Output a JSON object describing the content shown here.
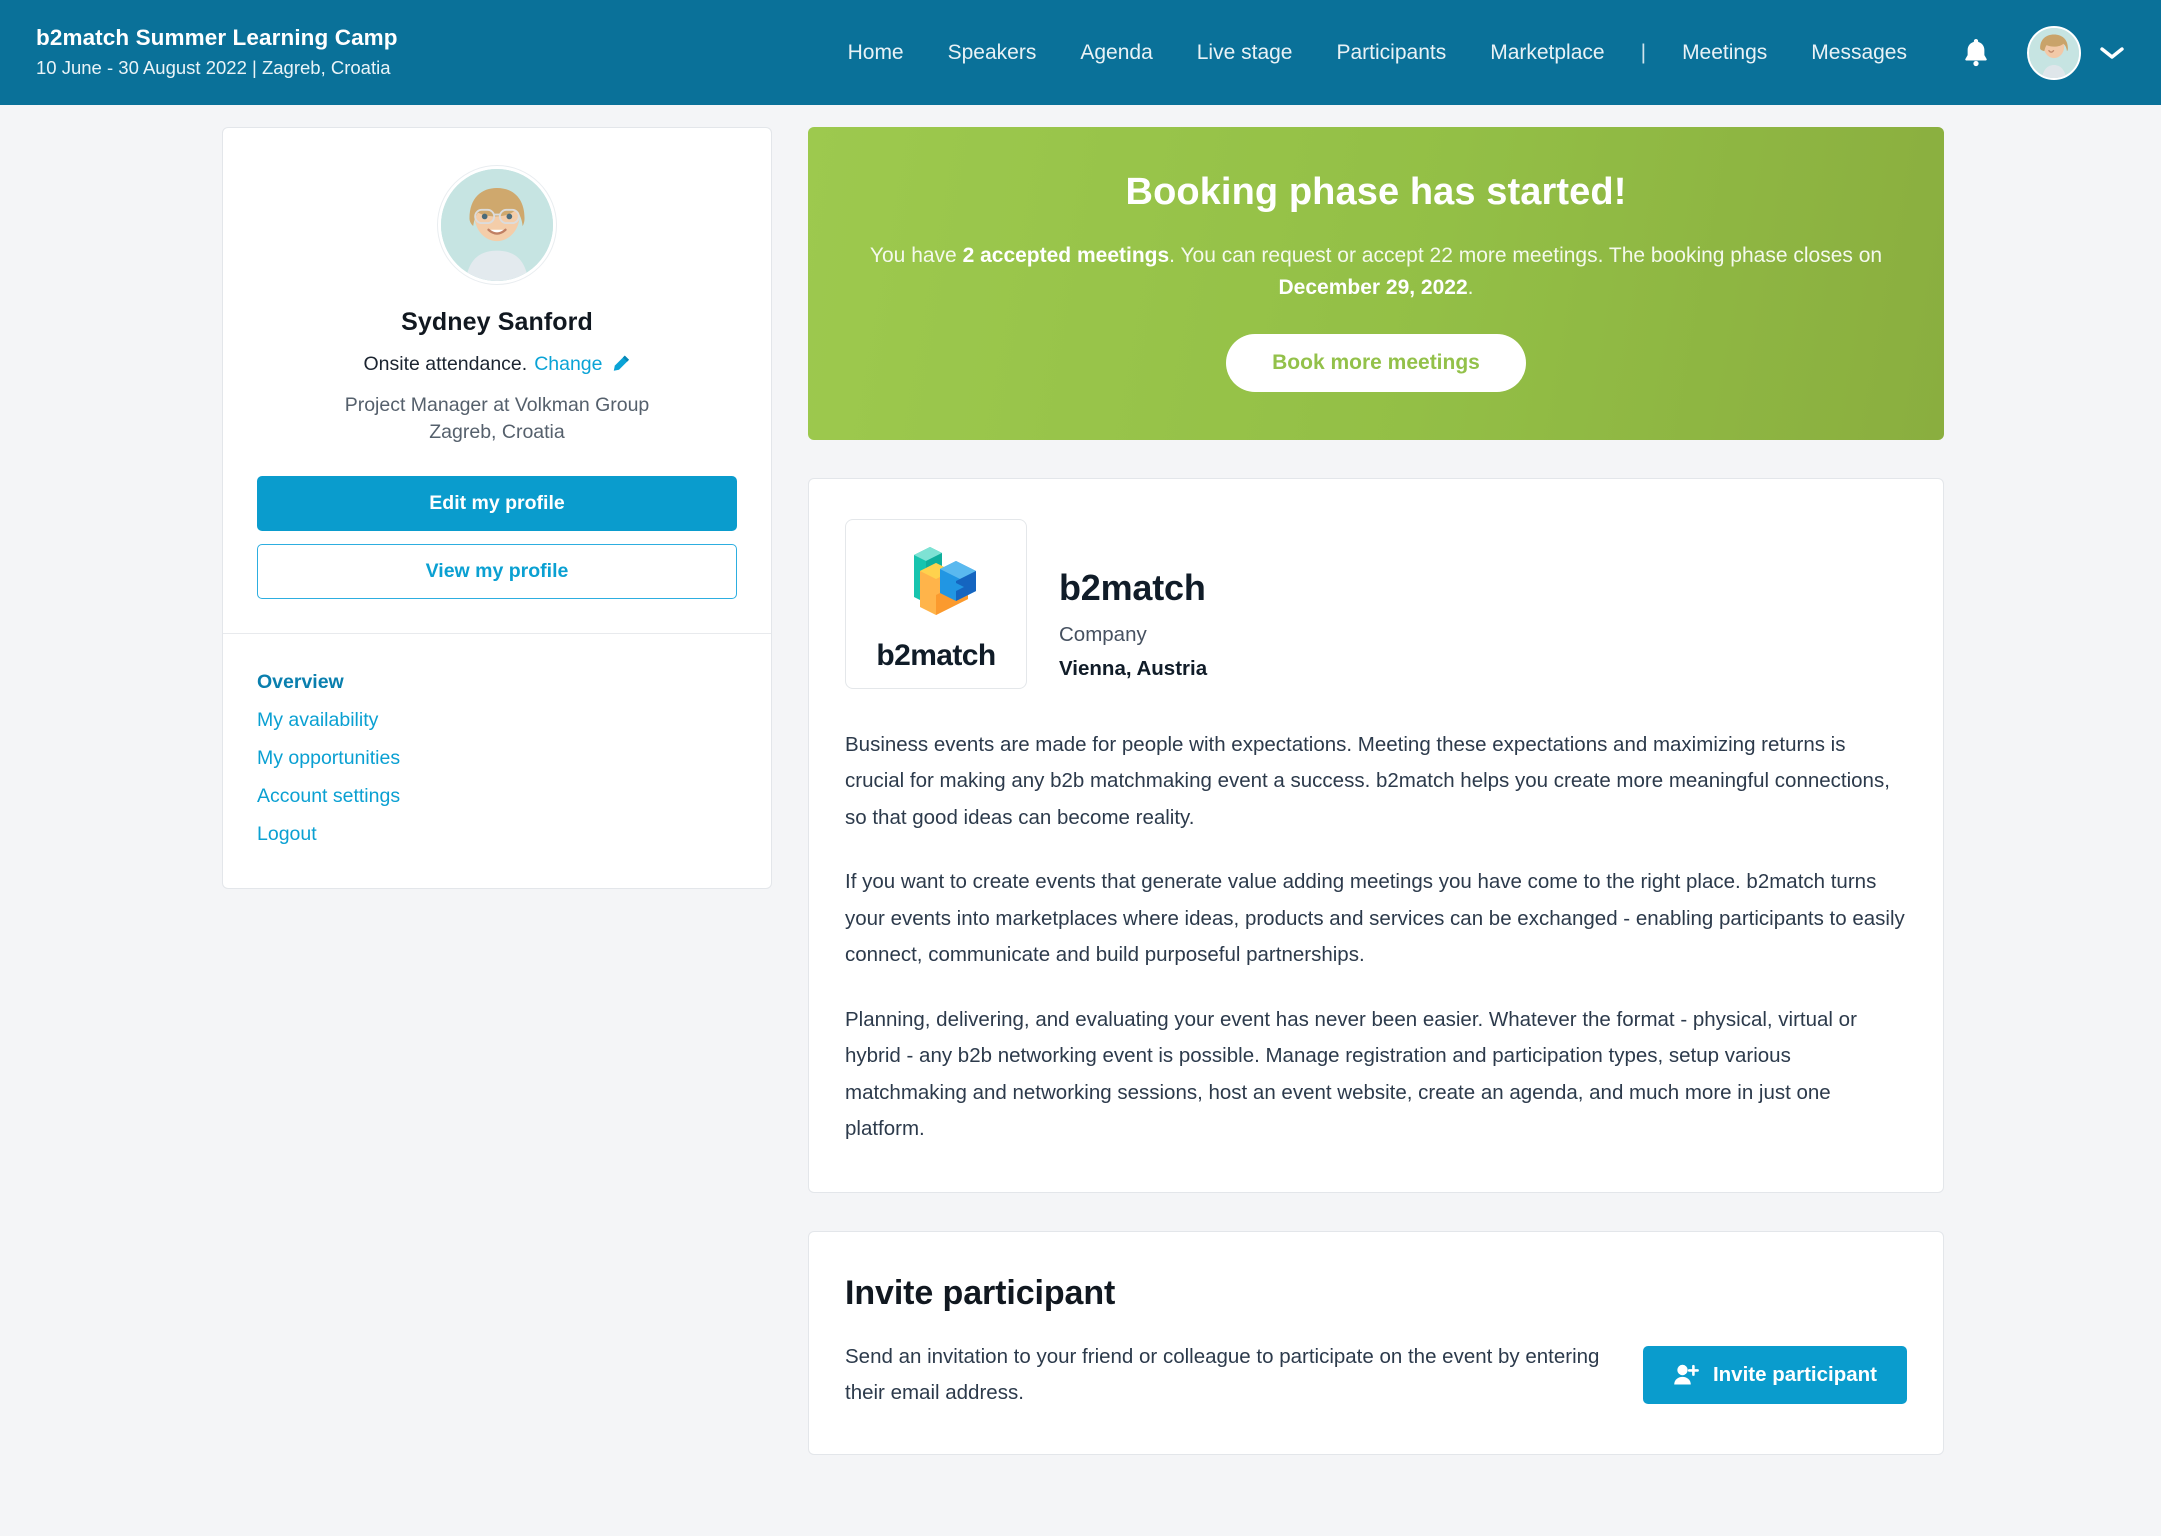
{
  "header": {
    "event_title": "b2match Summer Learning Camp",
    "event_subtitle": "10 June - 30 August 2022 | Zagreb, Croatia",
    "nav": [
      {
        "label": "Home"
      },
      {
        "label": "Speakers"
      },
      {
        "label": "Agenda"
      },
      {
        "label": "Live stage"
      },
      {
        "label": "Participants"
      },
      {
        "label": "Marketplace"
      }
    ],
    "separator": "|",
    "nav_right": [
      {
        "label": "Meetings"
      },
      {
        "label": "Messages"
      }
    ],
    "bell_icon": "bell-icon",
    "avatar_icon": "user-avatar",
    "chevron_icon": "chevron-down-icon",
    "bar_color": "#0a7199"
  },
  "profile": {
    "avatar_icon": "profile-avatar",
    "name": "Sydney Sanford",
    "attendance_text": "Onsite attendance.",
    "change_link": "Change",
    "pencil_icon": "pencil-icon",
    "role": "Project Manager at Volkman Group",
    "location": "Zagreb, Croatia",
    "edit_button": "Edit my profile",
    "view_button": "View my profile",
    "menu": [
      {
        "label": "Overview",
        "active": true
      },
      {
        "label": "My availability",
        "active": false
      },
      {
        "label": "My opportunities",
        "active": false
      },
      {
        "label": "Account settings",
        "active": false
      },
      {
        "label": "Logout",
        "active": false
      }
    ],
    "primary_color": "#0a9ccd",
    "link_color": "#0aa0d2"
  },
  "banner": {
    "title": "Booking phase has started!",
    "text_part1": "You have ",
    "accepted_meetings": "2 accepted meetings",
    "text_part2": ". You can request or accept 22 more meetings. The booking phase closes on ",
    "closing_date": "December 29, 2022",
    "text_part3": ".",
    "button": "Book more meetings",
    "color_start": "#9dc94e",
    "color_end": "#8aae3f"
  },
  "company": {
    "logo_icon": "b2match-logo-icon",
    "logo_word": "b2match",
    "name": "b2match",
    "type": "Company",
    "city": "Vienna, Austria",
    "paragraphs": [
      "Business events are made for people with expectations. Meeting these expectations and maximizing returns is crucial for making any b2b matchmaking event a success. b2match helps you create more meaningful connections, so that good ideas can become reality.",
      "If you want to create events that generate value adding meetings you have come to the right place. b2match turns your events into marketplaces where ideas, products and services can be exchanged - enabling participants to easily connect, communicate and build purposeful partnerships.",
      "Planning, delivering, and evaluating your event has never been easier. Whatever the format - physical, virtual or hybrid - any b2b networking event is possible. Manage registration and participation types, setup various matchmaking and networking sessions, host an event website, create an agenda, and much more in just one platform."
    ]
  },
  "invite": {
    "title": "Invite participant",
    "description": "Send an invitation to your friend or colleague to participate on the event by entering their email address.",
    "button": "Invite participant",
    "button_icon": "user-plus-icon"
  }
}
